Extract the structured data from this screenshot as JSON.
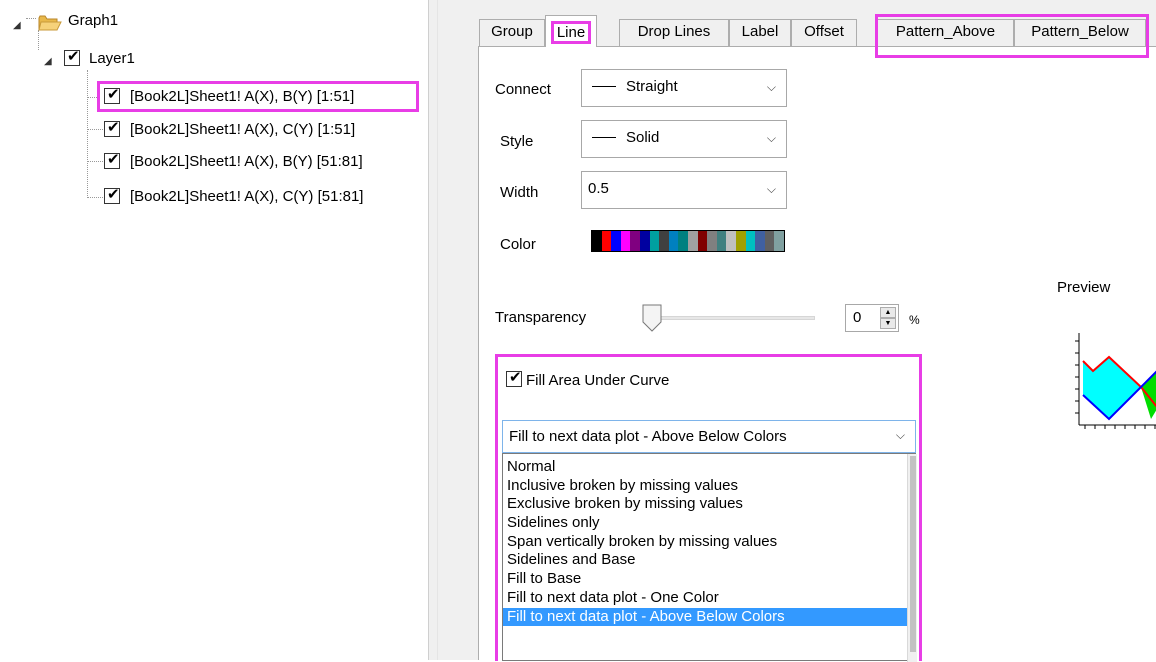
{
  "tree": {
    "root_label": "Graph1",
    "layer_label": "Layer1",
    "plots": [
      {
        "label": "[Book2L]Sheet1! A(X), B(Y) [1:51]",
        "checked": true,
        "highlighted": true
      },
      {
        "label": "[Book2L]Sheet1! A(X), C(Y) [1:51]",
        "checked": true
      },
      {
        "label": "[Book2L]Sheet1! A(X), B(Y) [51:81]",
        "checked": true
      },
      {
        "label": "[Book2L]Sheet1! A(X), C(Y) [51:81]",
        "checked": true
      }
    ]
  },
  "tabs": [
    {
      "label": "Group"
    },
    {
      "label": "Line",
      "active": true
    },
    {
      "label": "Drop Lines"
    },
    {
      "label": "Label"
    },
    {
      "label": "Offset"
    },
    {
      "label": "Pattern_Above"
    },
    {
      "label": "Pattern_Below"
    }
  ],
  "line": {
    "connect": {
      "label": "Connect",
      "value": "Straight"
    },
    "style": {
      "label": "Style",
      "value": "Solid"
    },
    "width": {
      "label": "Width",
      "value": "0.5"
    },
    "color": {
      "label": "Color",
      "swatches": [
        "#000000",
        "#ff0000",
        "#0000ff",
        "#ff00ff",
        "#800080",
        "#0000a0",
        "#00a0a0",
        "#404040",
        "#0080c0",
        "#008080",
        "#a0a0a0",
        "#800000",
        "#808080",
        "#408080",
        "#c0c0c0",
        "#a0a000",
        "#00c0c0",
        "#4060a0",
        "#606060",
        "#80a0a0"
      ]
    }
  },
  "transparency": {
    "label": "Transparency",
    "value": "0",
    "unit": "%",
    "level": 0
  },
  "preview": {
    "label": "Preview",
    "fill_above": "#00ffff",
    "fill_below": "#00dd00",
    "line_a": "#ff0000",
    "line_b": "#0000ff"
  },
  "fill": {
    "checkbox_label": "Fill Area Under Curve",
    "checked": true,
    "selected": "Fill to next data plot - Above Below Colors",
    "options": [
      "Normal",
      "Inclusive broken by missing values",
      "Exclusive broken by missing values",
      "Sidelines only",
      "Span vertically broken by missing values",
      "Sidelines and Base",
      "Fill to Base",
      "Fill to next data plot - One Color",
      "Fill to next data plot - Above Below Colors"
    ]
  },
  "colors": {
    "highlight": "#e83de6",
    "selection": "#3399ff"
  }
}
